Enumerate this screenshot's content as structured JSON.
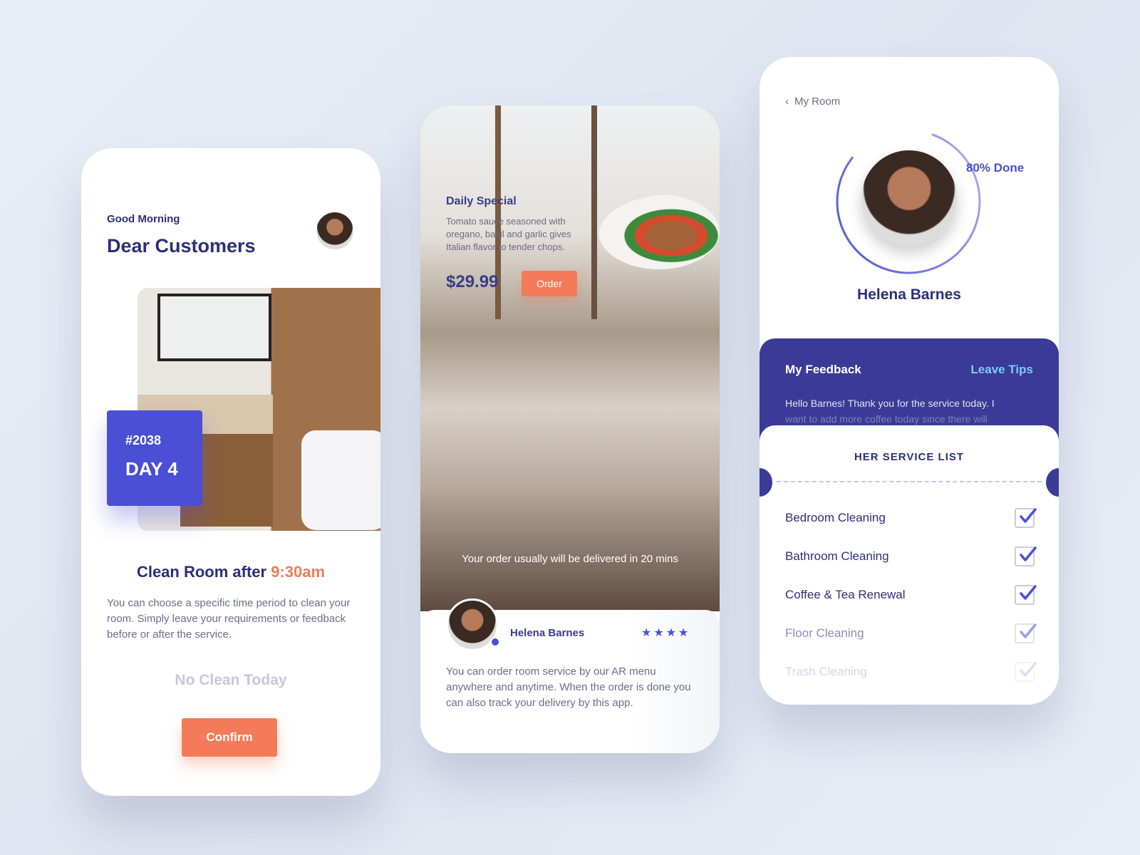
{
  "colors": {
    "primary": "#4a4fd6",
    "navy": "#2c2f7a",
    "accent": "#f47b59",
    "tips": "#7cc9ff"
  },
  "screen1": {
    "greeting": "Good Morning",
    "title": "Dear Customers",
    "room_number": "#2038",
    "day": "DAY 4",
    "clean_prefix": "Clean Room after",
    "clean_time": "9:30am",
    "description": "You can choose a specific time period to clean your room. Simply leave your requirements or feedback before or after the service.",
    "no_clean": "No Clean Today",
    "confirm": "Confirm"
  },
  "screen2": {
    "special_title": "Daily Special",
    "special_desc": "Tomato sauce seasoned with oregano, basil and garlic gives Italian flavor to tender chops.",
    "price": "$29.99",
    "order": "Order",
    "delivery_note": "Your order usually will be delivered in 20 mins",
    "staff_name": "Helena Barnes",
    "rating": 4,
    "stars": "★★★★",
    "description": "You can order room service by our AR menu anywhere and anytime. When the order is done you can also track your delivery by this app."
  },
  "screen3": {
    "back_label": "My Room",
    "progress_percent": 80,
    "progress_label": "80% Done",
    "name": "Helena Barnes",
    "feedback_title": "My Feedback",
    "leave_tips": "Leave Tips",
    "feedback_line1": "Hello Barnes! Thank you for the service today. I",
    "feedback_line2": "want to add more coffee today since there will",
    "list_title": "HER SERVICE LIST",
    "services": [
      {
        "label": "Bedroom Cleaning",
        "checked": true
      },
      {
        "label": "Bathroom Cleaning",
        "checked": true
      },
      {
        "label": "Coffee & Tea Renewal",
        "checked": true
      },
      {
        "label": "Floor Cleaning",
        "checked": true
      },
      {
        "label": "Trash Cleaning",
        "checked": true
      }
    ]
  }
}
